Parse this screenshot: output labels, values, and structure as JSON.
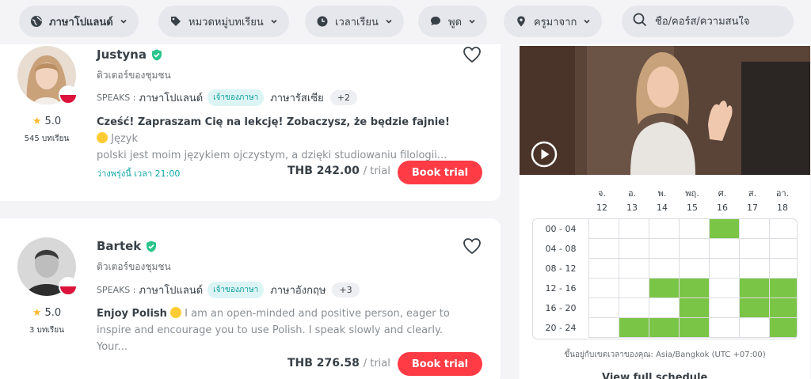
{
  "filters": {
    "language": "ภาษาโปแลนด์",
    "category": "หมวดหมู่บทเรียน",
    "time": "เวลาเรียน",
    "speaks": "พูด",
    "from": "ครูมาจาก",
    "search_placeholder": "ชื่อ/คอร์ส/ความสนใจ"
  },
  "tutors": [
    {
      "name": "Justyna",
      "type": "ติวเตอร์ของชุมชน",
      "speaks_label": "SPEAKS :",
      "lang1": "ภาษาโปแลนด์",
      "native_badge": "เจ้าของภาษา",
      "lang2": "ภาษารัสเซีย",
      "more": "+2",
      "rating": "5.0",
      "lessons": "545 บทเรียน",
      "headline": "Cześć! Zapraszam Cię na lekcję! Zobaczysz, że będzie fajnie!",
      "desc_line1": "Język",
      "desc_line2": "polski jest moim językiem ojczystym, a dzięki studiowaniu filologii...",
      "availability": "ว่างพรุ่งนี้ เวลา 21:00",
      "price": "THB 242.00",
      "trial": "/ trial",
      "book": "Book trial"
    },
    {
      "name": "Bartek",
      "type": "ติวเตอร์ของชุมชน",
      "speaks_label": "SPEAKS :",
      "lang1": "ภาษาโปแลนด์",
      "native_badge": "เจ้าของภาษา",
      "lang2": "ภาษาอังกฤษ",
      "more": "+3",
      "rating": "5.0",
      "lessons": "3 บทเรียน",
      "headline": "Enjoy Polish",
      "desc_line1": "I am an open-minded and positive person, eager to",
      "desc_line2": "inspire and encourage you to use Polish. I speak slowly and clearly. Your...",
      "price": "THB 276.58",
      "trial": "/ trial",
      "book": "Book trial"
    }
  ],
  "schedule": {
    "days": [
      {
        "name": "จ.",
        "date": "12"
      },
      {
        "name": "อ.",
        "date": "13"
      },
      {
        "name": "พ.",
        "date": "14"
      },
      {
        "name": "พฤ.",
        "date": "15"
      },
      {
        "name": "ศ.",
        "date": "16"
      },
      {
        "name": "ส.",
        "date": "17"
      },
      {
        "name": "อา.",
        "date": "18"
      }
    ],
    "slots": [
      {
        "label": "00 - 04",
        "on": [
          0,
          0,
          0,
          0,
          1,
          0,
          0
        ]
      },
      {
        "label": "04 - 08",
        "on": [
          0,
          0,
          0,
          0,
          0,
          0,
          0
        ]
      },
      {
        "label": "08 - 12",
        "on": [
          0,
          0,
          0,
          0,
          0,
          0,
          0
        ]
      },
      {
        "label": "12 - 16",
        "on": [
          0,
          0,
          1,
          1,
          0,
          1,
          1
        ]
      },
      {
        "label": "16 - 20",
        "on": [
          0,
          0,
          0,
          1,
          0,
          1,
          1
        ]
      },
      {
        "label": "20 - 24",
        "on": [
          0,
          1,
          1,
          1,
          0,
          0,
          1
        ]
      }
    ],
    "timezone_note": "ขึ้นอยู่กับเขตเวลาของคุณ: Asia/Bangkok (UTC +07:00)",
    "view_full": "View full schedule"
  },
  "colors": {
    "accent": "#ff3c46",
    "available": "#7bc546",
    "native_badge": "#0e9f9f",
    "star": "#fdb833"
  }
}
